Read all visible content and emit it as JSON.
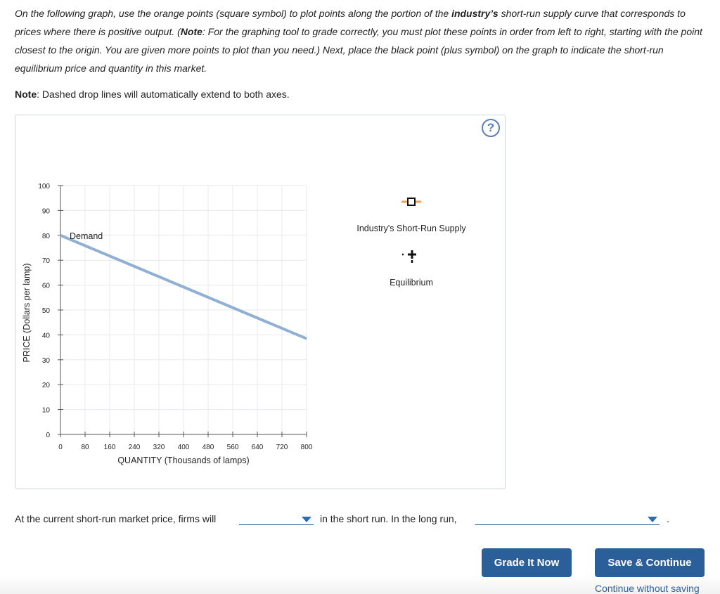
{
  "instructions": {
    "p1": "On the following graph, use the orange points (square symbol) to plot points along the portion of the ",
    "p1_bold": "industry’s",
    "p2": " short-run supply curve that corresponds to prices where there is positive output. (",
    "p2_bold": "Note",
    "p3": ": For the graphing tool to grade correctly, you must plot these points in order from left to right, starting with the point closest to the origin. You are given more points to plot than you need.) Next, place the black point (plus symbol) on the graph to indicate the short-run equilibrium price and quantity in this market."
  },
  "note": {
    "label": "Note",
    "text": ": Dashed drop lines will automatically extend to both axes."
  },
  "help_icon": "?",
  "chart_data": {
    "type": "line",
    "xlabel": "QUANTITY (Thousands of lamps)",
    "ylabel": "PRICE (Dollars per lamp)",
    "xlim": [
      0,
      800
    ],
    "ylim": [
      0,
      100
    ],
    "x_ticks": [
      "0",
      "80",
      "160",
      "240",
      "320",
      "400",
      "480",
      "560",
      "640",
      "720",
      "800"
    ],
    "y_ticks": [
      "0",
      "10",
      "20",
      "30",
      "40",
      "50",
      "60",
      "70",
      "80",
      "90",
      "100"
    ],
    "grid": true,
    "series": [
      {
        "name": "Demand",
        "color": "#8fb0d4",
        "x": [
          0,
          800
        ],
        "y": [
          80,
          38.5
        ]
      }
    ]
  },
  "legend": {
    "supply_label": "Industry's Short-Run Supply",
    "supply_color": "#f0a24a",
    "supply_icon": "orange-square-point-icon",
    "equilibrium_label": "Equilibrium",
    "equilibrium_icon": "black-plus-point-icon"
  },
  "question": {
    "part1": "At the current short-run market price, firms will",
    "part2": "in the short run. In the long run,",
    "part3": ".",
    "dropdown1_value": "",
    "dropdown2_value": ""
  },
  "buttons": {
    "grade": "Grade It Now",
    "save": "Save & Continue",
    "continue_link": "Continue without saving"
  }
}
